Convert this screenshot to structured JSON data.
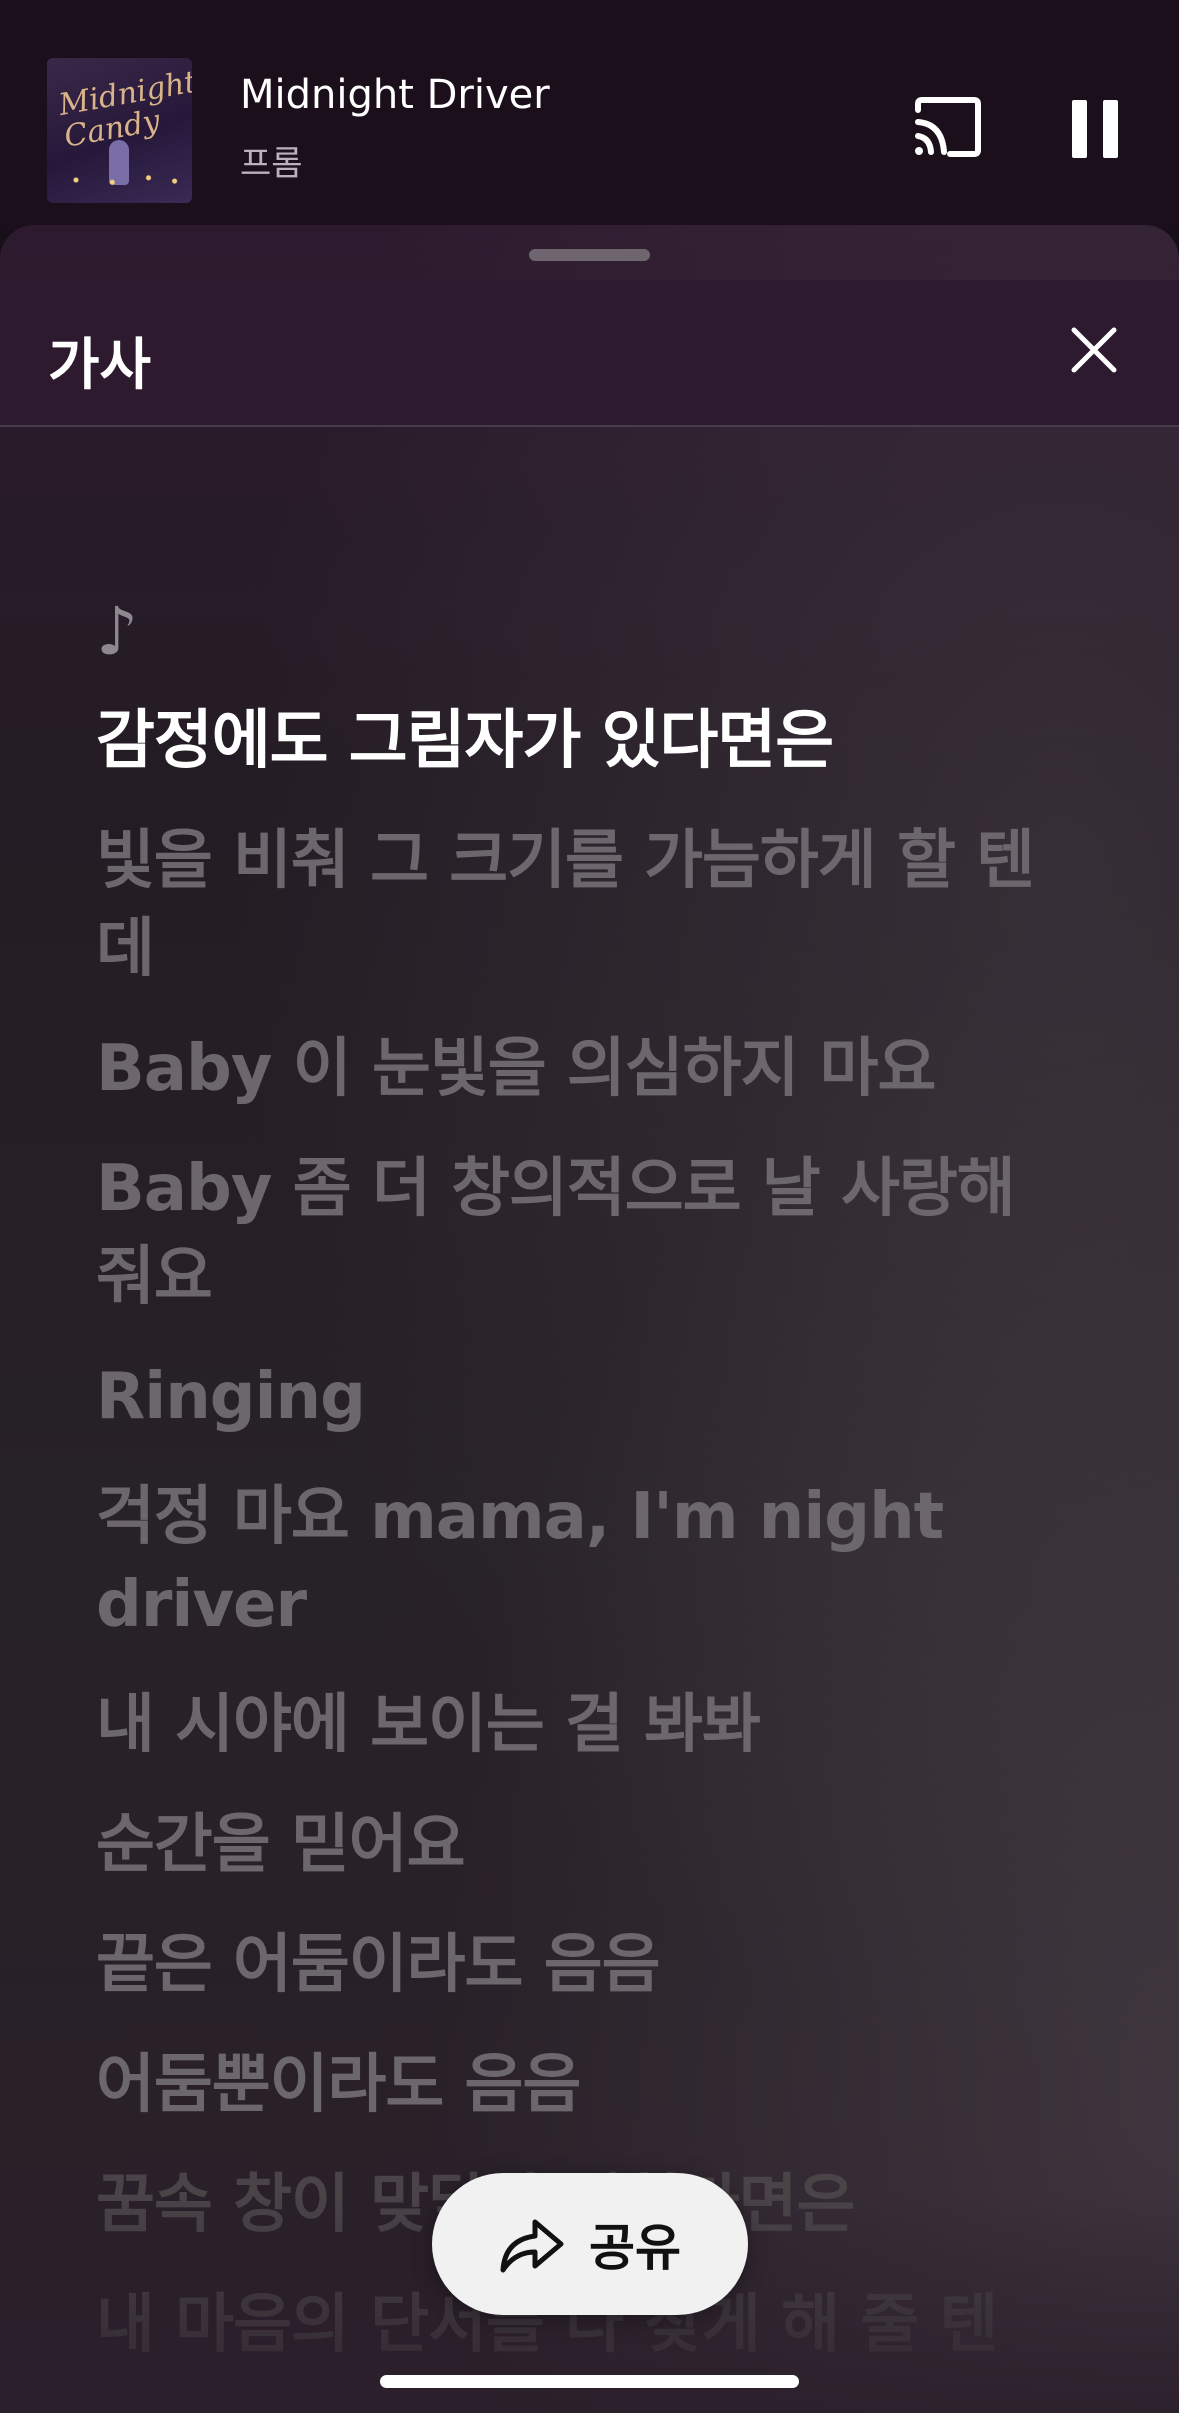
{
  "now_playing": {
    "title": "Midnight Driver",
    "artist": "프롬",
    "album_art_text": "Midnight Candy",
    "cast_icon": "cast-icon",
    "pause_icon": "pause-icon"
  },
  "sheet": {
    "title": "가사",
    "close_icon": "close-icon"
  },
  "lyrics": {
    "intro_symbol": "♪",
    "active_index": 0,
    "lines": [
      "감정에도 그림자가 있다면은",
      "빛을 비춰 그 크기를 가늠하게 할 텐데",
      "Baby 이 눈빛을 의심하지 마요",
      "Baby 좀 더 창의적으로 날 사랑해줘요",
      "Ringing",
      "걱정 마요 mama, I'm night driver",
      "내 시야에 보이는 걸 봐봐",
      "순간을 믿어요",
      "끝은 어둠이라도 음음",
      "어둠뿐이라도 음음",
      "꿈속 창이 맞닿아 비친다면은",
      "내 마음의 단서를 다 찾게 해 줄 텐"
    ]
  },
  "share": {
    "label": "공유",
    "icon": "share-arrow-icon"
  },
  "colors": {
    "active_lyric": "#ffffff",
    "inactive_lyric": "#6c676d",
    "sheet_header": "#2d1a2e",
    "share_bg": "#f2f1f2"
  }
}
